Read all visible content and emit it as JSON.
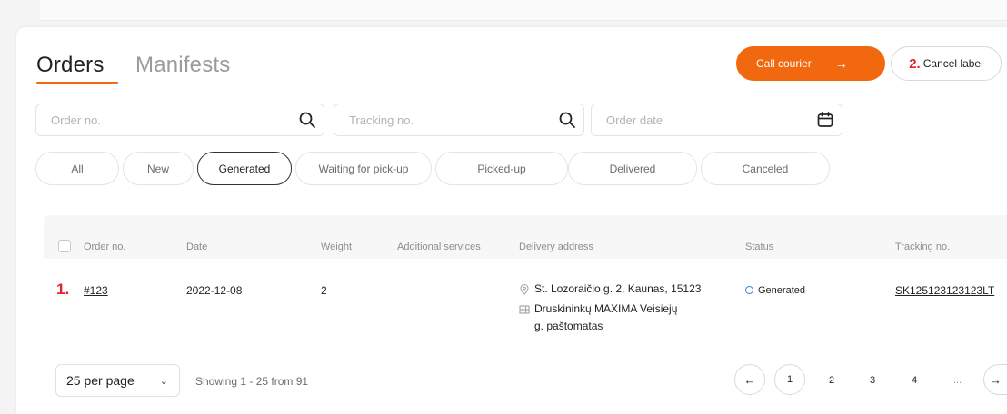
{
  "tabs": {
    "orders": "Orders",
    "manifests": "Manifests"
  },
  "header": {
    "call_courier": "Call courier",
    "cancel_label": "Cancel label",
    "cancel_marker": "2."
  },
  "filters": {
    "order_no_placeholder": "Order no.",
    "tracking_no_placeholder": "Tracking no.",
    "order_date_placeholder": "Order date"
  },
  "status_chips": [
    "All",
    "New",
    "Generated",
    "Waiting for pick-up",
    "Picked-up",
    "Delivered",
    "Canceled"
  ],
  "active_chip": "Generated",
  "table": {
    "columns": [
      "Order no.",
      "Date",
      "Weight",
      "Additional services",
      "Delivery address",
      "Status",
      "Tracking no."
    ],
    "rows": [
      {
        "marker": "1.",
        "order_no": "#123",
        "date": "2022-12-08",
        "weight": "2",
        "additional_services": "",
        "address_line": "St. Lozoraičio g. 2, Kaunas, 15123",
        "terminal_line1": "Druskininkų MAXIMA Veisiejų",
        "terminal_line2": "g. paštomatas",
        "status": "Generated",
        "tracking_no": "SK125123123123LT"
      }
    ]
  },
  "pagination": {
    "per_page": "25 per page",
    "showing": "Showing 1 - 25 from 91",
    "pages": [
      "1",
      "2",
      "3",
      "4",
      "..."
    ],
    "current_page": "1"
  },
  "colors": {
    "accent": "#f2680f",
    "marker": "#e0252c",
    "status": "#2a7de1"
  }
}
